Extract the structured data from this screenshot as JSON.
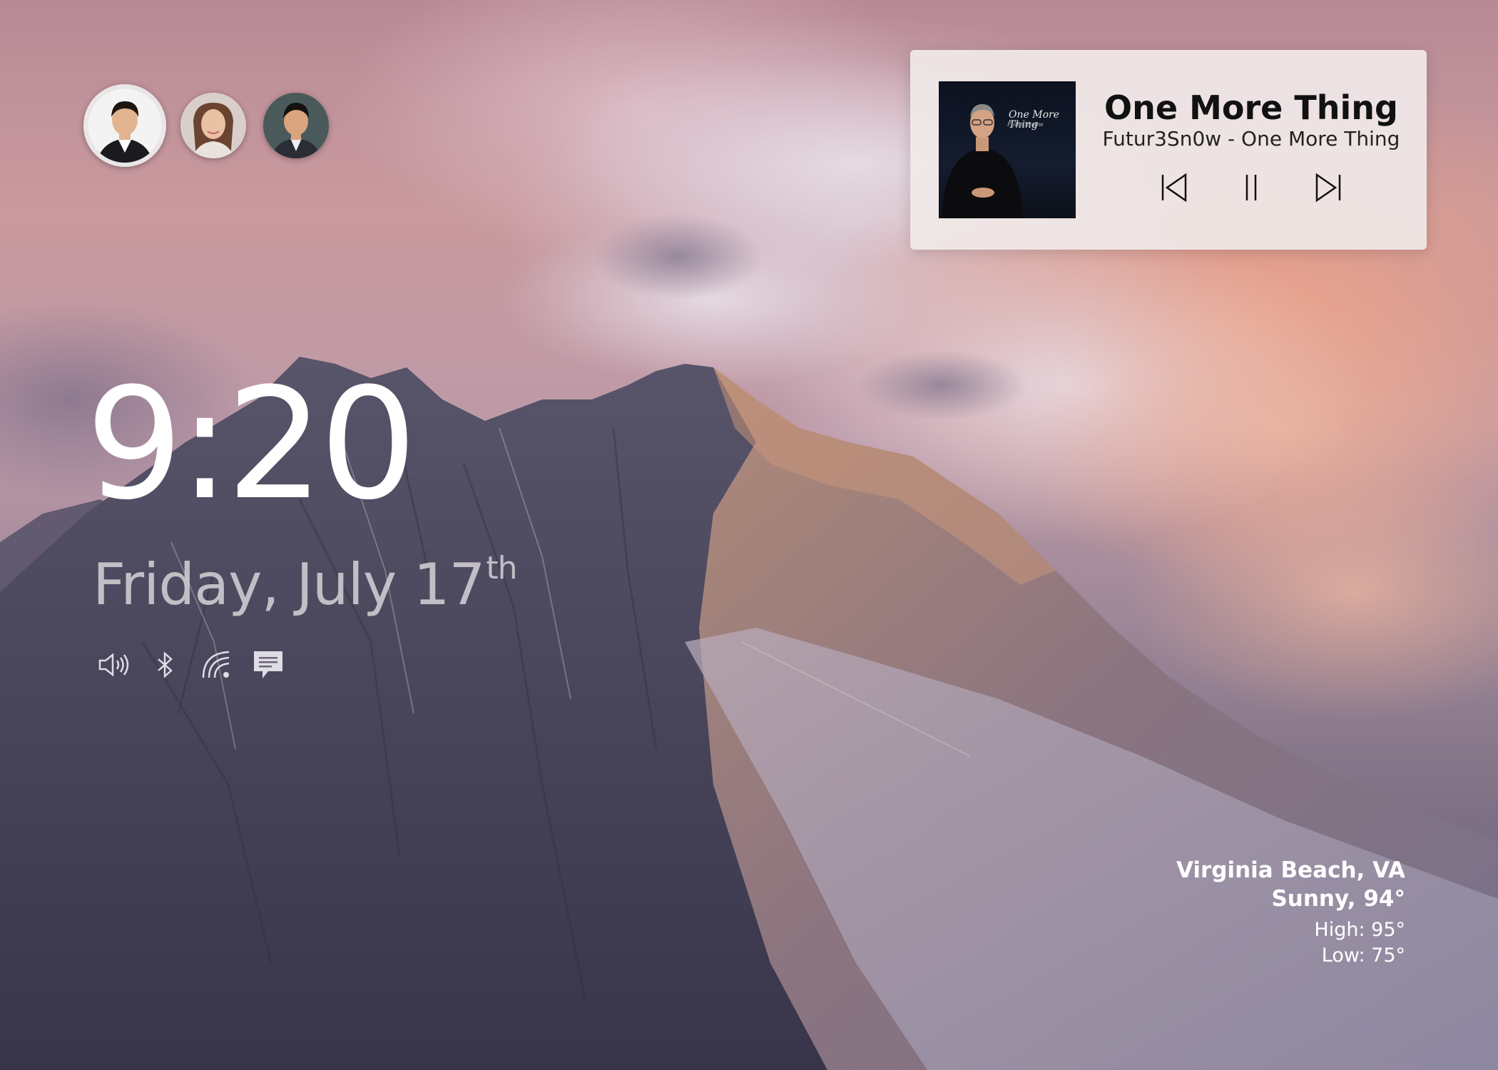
{
  "users": [
    {
      "name": "user-1",
      "active": true,
      "skin": "#e2b48f",
      "hair": "#1d1510",
      "shirt": "#1b1b1f",
      "bg": "#f3f3f3"
    },
    {
      "name": "user-2",
      "active": false,
      "skin": "#e9c1a3",
      "hair": "#6a4430",
      "shirt": "#e9e3de",
      "bg": "#d9cfca"
    },
    {
      "name": "user-3",
      "active": false,
      "skin": "#d9a47e",
      "hair": "#151210",
      "shirt": "#2a2d34",
      "bg": "#4a5a5a"
    }
  ],
  "clock": {
    "time": "9:20",
    "date": "Friday, July 17",
    "date_suffix": "th"
  },
  "status_icons": [
    "volume-icon",
    "bluetooth-icon",
    "wifi-icon",
    "notification-icon"
  ],
  "media": {
    "title": "One More Thing",
    "subtitle": "Futur3Sn0w - One More Thing",
    "album_art_text": "One More Thing",
    "album_art_sub": "Futur3Sn0w",
    "controls": [
      "previous-icon",
      "pause-icon",
      "next-icon"
    ]
  },
  "weather": {
    "location": "Virginia Beach, VA",
    "condition": "Sunny, 94°",
    "high": "High: 95°",
    "low": "Low: 75°"
  },
  "colors": {
    "clock_text": "#ffffff",
    "date_text": "#d7d2d7",
    "media_panel": "#f0e8e8",
    "media_text": "#111111"
  }
}
